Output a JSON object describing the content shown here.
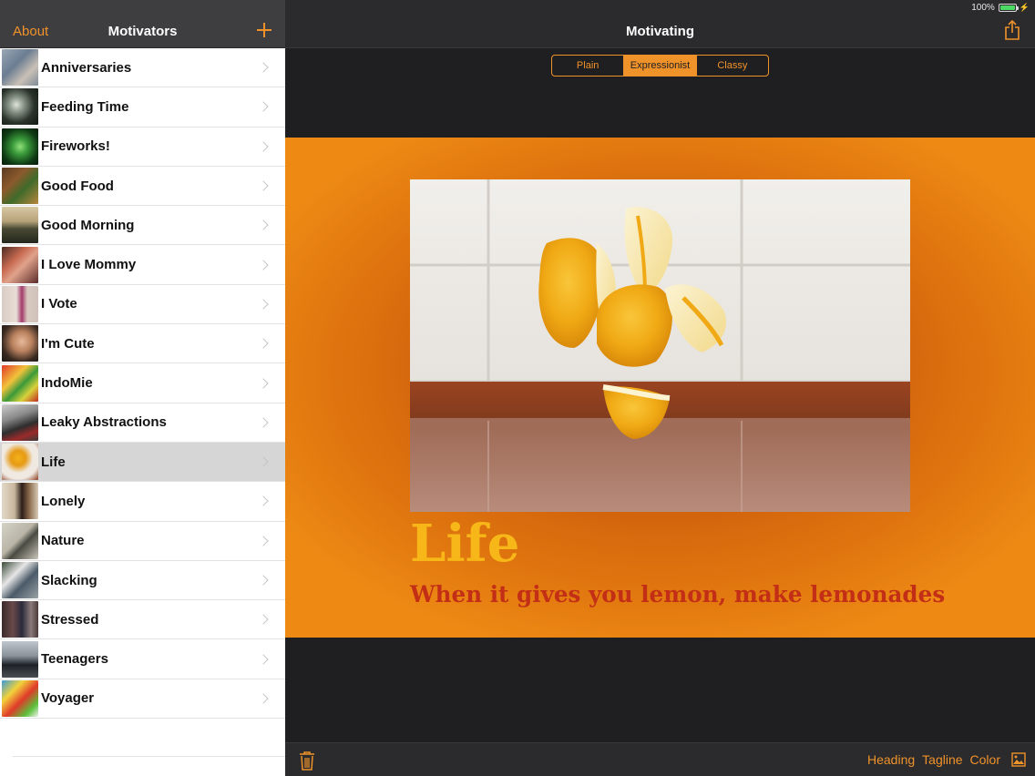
{
  "status": {
    "battery": "100%"
  },
  "master": {
    "about_label": "About",
    "title": "Motivators",
    "items": [
      {
        "label": "Anniversaries"
      },
      {
        "label": "Feeding Time"
      },
      {
        "label": "Fireworks!"
      },
      {
        "label": "Good Food"
      },
      {
        "label": "Good Morning"
      },
      {
        "label": "I Love Mommy"
      },
      {
        "label": "I Vote"
      },
      {
        "label": "I'm Cute"
      },
      {
        "label": "IndoMie"
      },
      {
        "label": "Leaky Abstractions"
      },
      {
        "label": "Life"
      },
      {
        "label": "Lonely"
      },
      {
        "label": "Nature"
      },
      {
        "label": "Slacking"
      },
      {
        "label": "Stressed"
      },
      {
        "label": "Teenagers"
      },
      {
        "label": "Voyager"
      }
    ],
    "selected_item": "Life"
  },
  "detail": {
    "title": "Motivating",
    "segments": [
      {
        "label": "Plain"
      },
      {
        "label": "Expressionist"
      },
      {
        "label": "Classy"
      }
    ],
    "active_segment": "Expressionist",
    "poster": {
      "heading": "Life",
      "tagline": "When it gives you lemon, make lemonades"
    },
    "toolbar": {
      "heading_label": "Heading",
      "tagline_label": "Tagline",
      "color_label": "Color"
    }
  },
  "colors": {
    "accent": "#f0922a",
    "poster_background": "#ee8a14",
    "heading_color": "#f7b718",
    "tagline_color": "#c32f16",
    "selected_row": "#d6d6d6"
  }
}
